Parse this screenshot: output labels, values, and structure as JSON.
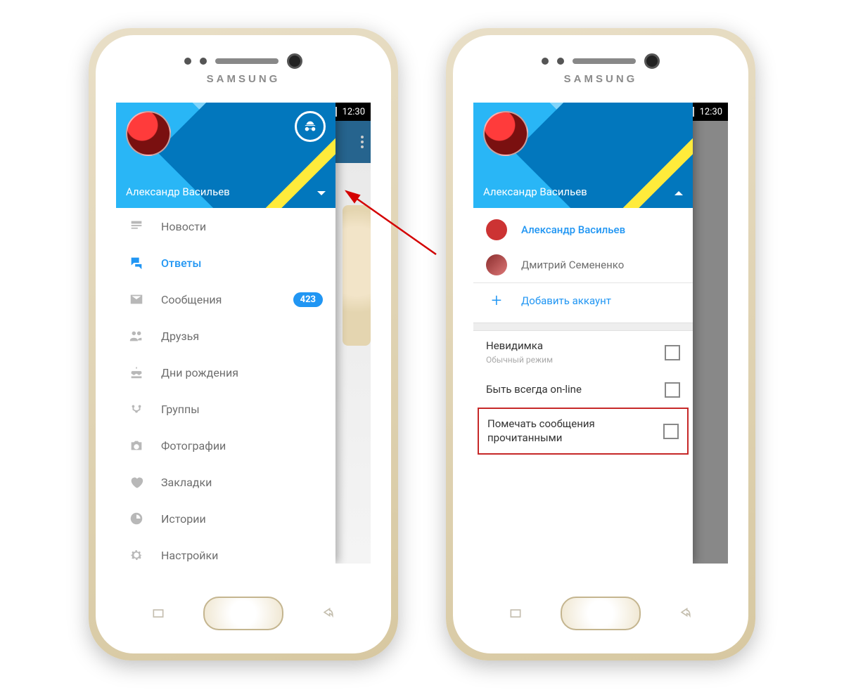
{
  "device_brand": "SAMSUNG",
  "status": {
    "time": "12:30"
  },
  "header": {
    "user_name": "Александр Васильев"
  },
  "menu": {
    "news": "Новости",
    "replies": "Ответы",
    "messages": "Сообщения",
    "messages_badge": "423",
    "friends": "Друзья",
    "birthdays": "Дни рождения",
    "groups": "Группы",
    "photos": "Фотографии",
    "bookmarks": "Закладки",
    "stories": "Истории",
    "settings": "Настройки"
  },
  "accounts": {
    "primary": "Александр Васильев",
    "secondary": "Дмитрий Семененко",
    "add": "Добавить аккаунт"
  },
  "settings": {
    "invisible": "Невидимка",
    "invisible_sub": "Обычный режим",
    "always_online": "Быть всегда on-line",
    "mark_read": "Помечать сообщения прочитанными"
  }
}
